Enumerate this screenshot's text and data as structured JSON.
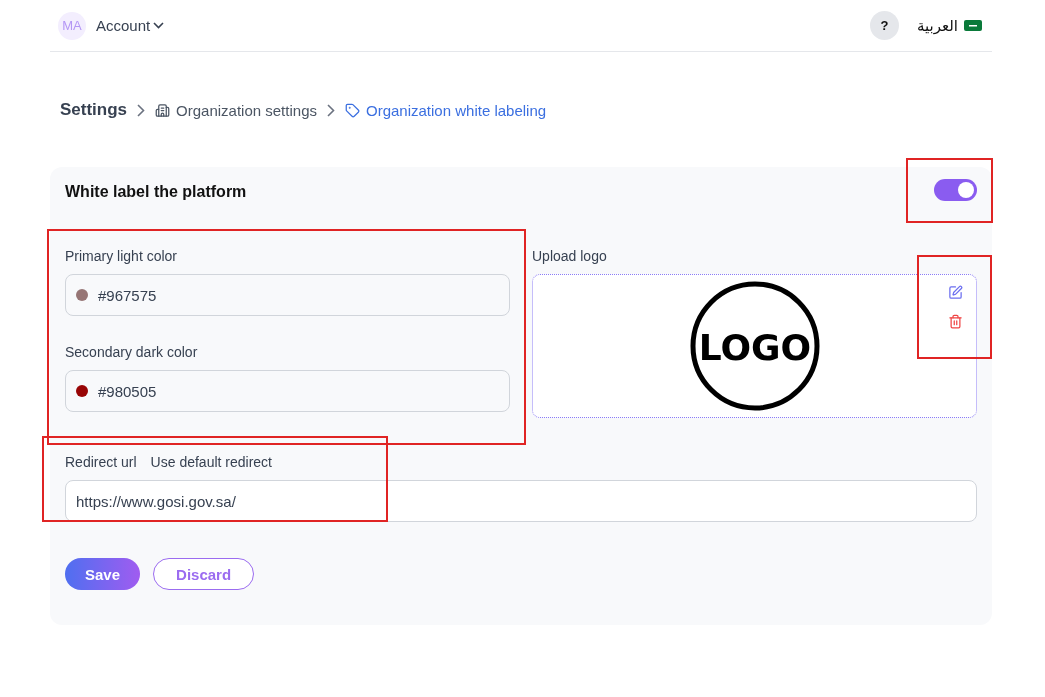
{
  "topbar": {
    "avatar": "MA",
    "account": "Account",
    "help": "?",
    "language": "العربية"
  },
  "breadcrumb": [
    {
      "label": "Settings",
      "kind": "root",
      "selected": false
    },
    {
      "label": "Organization settings",
      "kind": "building",
      "selected": false
    },
    {
      "label": "Organization white labeling",
      "kind": "tag",
      "selected": true
    }
  ],
  "card": {
    "title": "White label the platform",
    "toggle": {
      "on": true,
      "highlighted": true
    },
    "colors": {
      "highlighted": true,
      "fields": [
        {
          "label": "Primary light color",
          "value": "#967575",
          "color": "#967575"
        },
        {
          "label": "Secondary dark color",
          "value": "#980505",
          "color": "#980505"
        }
      ]
    },
    "upload": {
      "label": "Upload logo",
      "logo_text": "LOGO",
      "actions_highlighted": true
    },
    "redirect": {
      "label": "Redirect url",
      "option": "Use default redirect",
      "value": "https://www.gosi.gov.sa/",
      "highlighted": true
    },
    "buttons": [
      {
        "label": "Save",
        "kind": "primary"
      },
      {
        "label": "Discard",
        "kind": "outline"
      }
    ]
  }
}
